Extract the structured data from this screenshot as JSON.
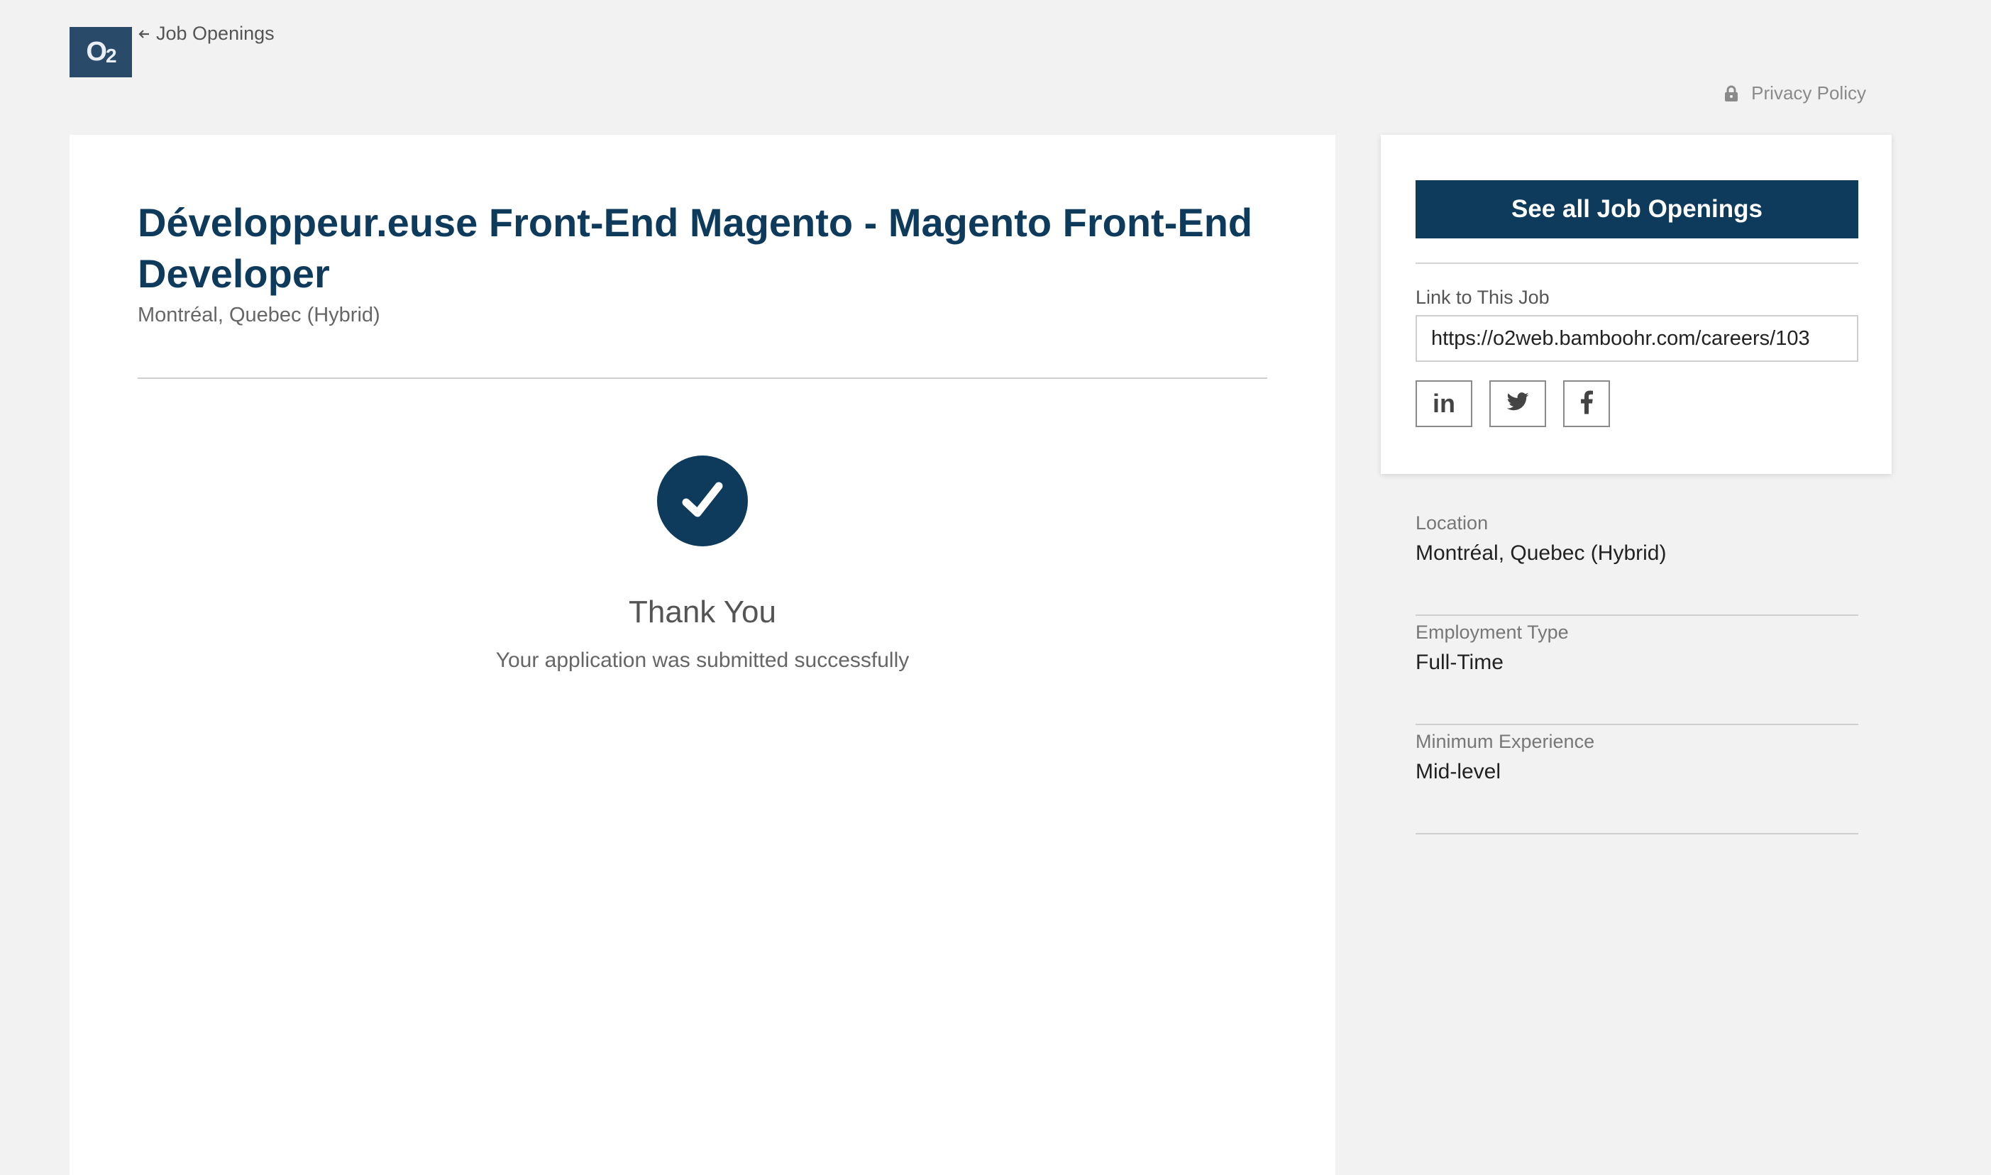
{
  "header": {
    "logo_text": "O",
    "logo_sub": "2",
    "privacy_label": "Privacy Policy"
  },
  "job": {
    "back_label": "Job Openings",
    "title": "Développeur.euse Front-End Magento - Magento Front-End Developer",
    "location": "Montréal, Quebec (Hybrid)"
  },
  "confirmation": {
    "title": "Thank You",
    "message": "Your application was submitted successfully"
  },
  "sidebar": {
    "see_all_label": "See all Job Openings",
    "link_label": "Link to This Job",
    "link_value": "https://o2web.bamboohr.com/careers/103",
    "social": [
      {
        "name": "linkedin-icon"
      },
      {
        "name": "twitter-icon"
      },
      {
        "name": "facebook-icon"
      }
    ]
  },
  "details": [
    {
      "label": "Location",
      "value": "Montréal, Quebec (Hybrid)"
    },
    {
      "label": "Employment Type",
      "value": "Full-Time"
    },
    {
      "label": "Minimum Experience",
      "value": "Mid-level"
    }
  ],
  "colors": {
    "brand_navy": "#0e3a5c",
    "logo_bg": "#2a4a6a",
    "page_bg": "#f2f2f2"
  }
}
